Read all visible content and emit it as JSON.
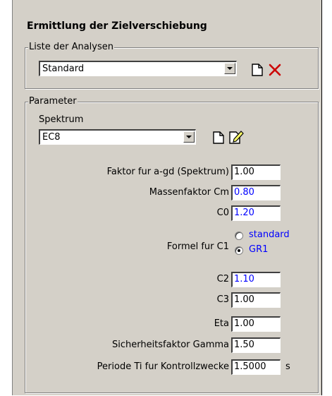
{
  "title": "Ermittlung der Zielverschiebung",
  "analyses": {
    "legend": "Liste der Analysen",
    "selected": "Standard"
  },
  "parameters": {
    "legend": "Parameter",
    "spectrum_label": "Spektrum",
    "spectrum_selected": "EC8",
    "fields": {
      "faktor_agd": {
        "label": "Faktor fur a-gd (Spektrum)",
        "value": "1.00"
      },
      "massenfaktor": {
        "label": "Massenfaktor Cm",
        "value": "0.80"
      },
      "c0": {
        "label": "C0",
        "value": "1.20"
      },
      "formel_c1": {
        "label": "Formel fur C1",
        "options": [
          "standard",
          "GR1"
        ],
        "selected": "GR1"
      },
      "c2": {
        "label": "C2",
        "value": "1.10"
      },
      "c3": {
        "label": "C3",
        "value": "1.00"
      },
      "eta": {
        "label": "Eta",
        "value": "1.00"
      },
      "gamma": {
        "label": "Sicherheitsfaktor Gamma",
        "value": "1.50"
      },
      "periode": {
        "label": "Periode Ti fur Kontrollzwecke",
        "value": "1.5000",
        "unit": "s"
      }
    }
  },
  "icons": {
    "new_analysis": "new-document-icon",
    "delete_analysis": "delete-x-icon",
    "new_spectrum": "new-document-icon",
    "edit_spectrum": "edit-document-icon"
  },
  "colors": {
    "panel": "#d4d0c8",
    "modified_value": "#0000ff",
    "delete": "#cc0000"
  }
}
